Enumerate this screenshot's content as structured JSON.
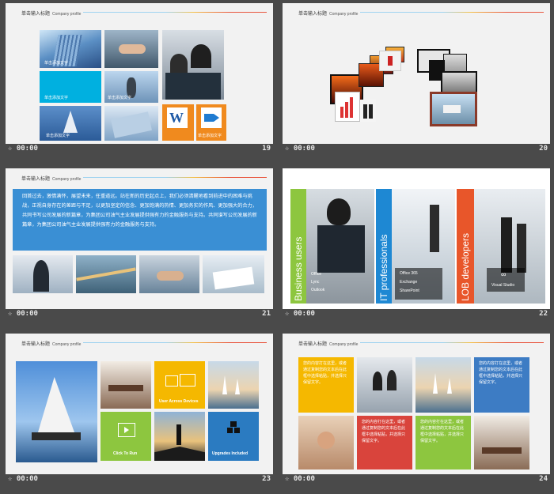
{
  "slide_header": {
    "cn": "单击输入标题",
    "en": "Company profile"
  },
  "footer_time": "00:00",
  "slides": [
    {
      "number": "19",
      "captions": [
        "单击添加文字",
        "单击添加文字",
        "单击添加文字",
        "单击添加文字",
        "单击添加文字"
      ]
    },
    {
      "number": "20"
    },
    {
      "number": "21",
      "paragraph": "回首过去，激情满怀，展望未来，任重道远。站在新的历史起点上，我们必须清醒地看到前进中的困难与挑战，正视自身存在的差距与不足，以更加坚定的信念、更加饱满的热情、更加务实的作风、更加强大的合力，共同书写公司发展的新篇章，为集团公司油气主业发展提供强有力的金融服务与支持。共同谱写公司发展的新篇章，为集团公司油气主业发展提供强有力的金融服务与支持。"
    },
    {
      "number": "22",
      "panels": [
        {
          "title": "Business users",
          "items": [
            "Office",
            "Lync",
            "Outlook"
          ],
          "color": "#8dc63f"
        },
        {
          "title": "IT professionals",
          "items": [
            "Office 365",
            "Exchange",
            "SharePoint"
          ],
          "color": "#1e88d3"
        },
        {
          "title": "LOB developers",
          "items": [
            "Visual Studio"
          ],
          "color": "#e8562a"
        }
      ]
    },
    {
      "number": "23",
      "tiles": [
        {
          "label": "User Across Devices",
          "color": "#f5b800"
        },
        {
          "label": "Click To Run",
          "color": "#8dc63f"
        },
        {
          "label": "Upgrades Included",
          "color": "#2b7bc1"
        }
      ]
    },
    {
      "number": "24",
      "tiles": [
        {
          "text": "您的内容打在这里，或者通过复制您的文本后在此框中选择粘贴，并选择只保留文字。",
          "color": "#f5b800"
        },
        {
          "text": "您的内容打在这里，或者通过复制您的文本后在此框中选择粘贴，并选择只保留文字。",
          "color": "#3d7cc4"
        },
        {
          "text": "您的内容打在这里，或者通过复制您的文本后在此框中选择粘贴，并选择只保留文字。",
          "color": "#d9443c"
        },
        {
          "text": "您的内容打在这里，或者通过复制您的文本后在此框中选择粘贴，并选择只保留文字。",
          "color": "#8dc63f"
        }
      ]
    }
  ]
}
